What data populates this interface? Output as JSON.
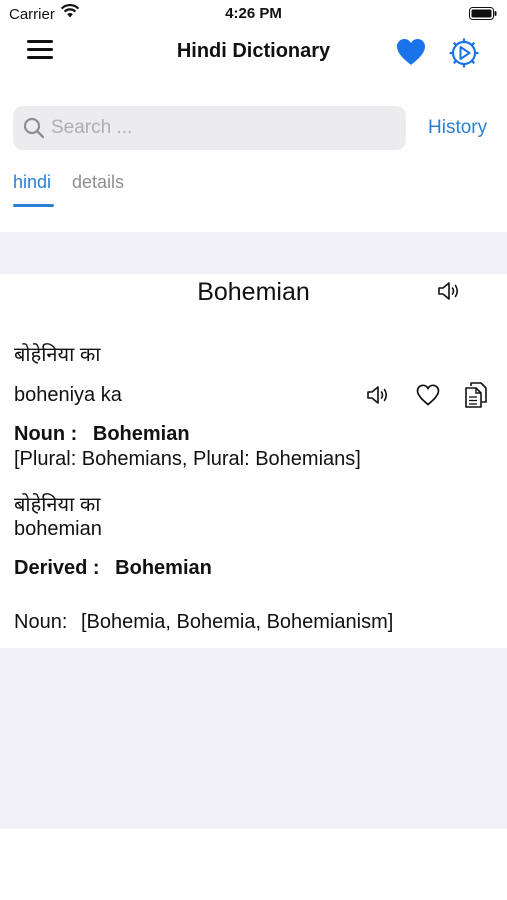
{
  "status_bar": {
    "carrier": "Carrier",
    "time": "4:26 PM"
  },
  "nav": {
    "title": "Hindi Dictionary"
  },
  "search": {
    "placeholder": "Search ...",
    "value": "",
    "history_label": "History"
  },
  "tabs": [
    {
      "label": "hindi",
      "active": true
    },
    {
      "label": "details",
      "active": false
    }
  ],
  "entry": {
    "word": "Bohemian",
    "hindi": "बोहेनिया का",
    "transliteration": "boheniya ka",
    "noun_label": "Noun :",
    "noun_word": "Bohemian",
    "plurals": "[Plural: Bohemians, Plural: Bohemians]",
    "hindi2": "बोहेनिया का",
    "translit2": "bohemian",
    "derived_label": "Derived :",
    "derived_word": "Bohemian",
    "derived_noun_label": "Noun:",
    "derived_nouns": "[Bohemia, Bohemia, Bohemianism]"
  },
  "colors": {
    "accent": "#2b7fd6",
    "heart": "#1a73e8",
    "band": "#efeff4"
  },
  "icons": [
    "menu-icon",
    "heart-icon",
    "settings-icon",
    "search-icon",
    "speaker-icon",
    "heart-outline-icon",
    "copy-icon"
  ]
}
